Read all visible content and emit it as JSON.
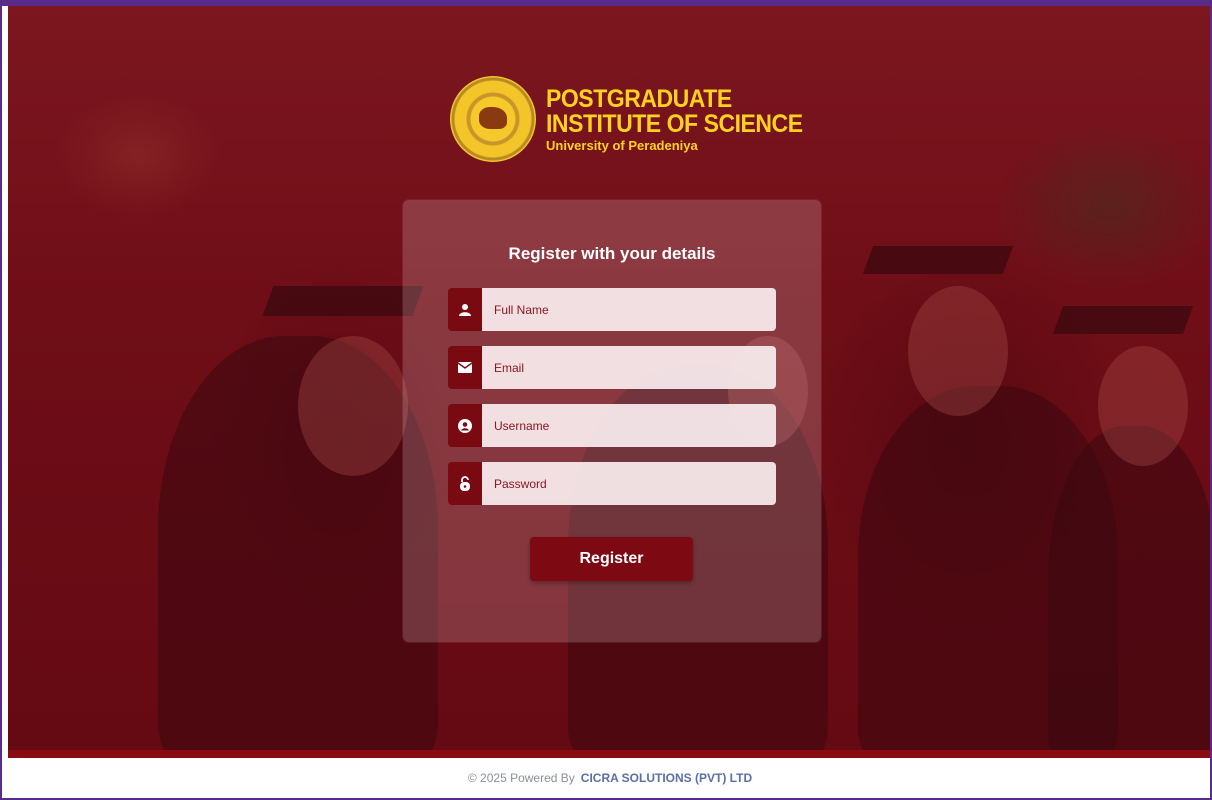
{
  "logo": {
    "line1": "POSTGRADUATE",
    "line2": "INSTITUTE OF SCIENCE",
    "line3": "University of Peradeniya"
  },
  "form": {
    "heading": "Register with your details",
    "fields": [
      {
        "icon": "user-icon",
        "placeholder": "Full Name"
      },
      {
        "icon": "envelope-icon",
        "placeholder": "Email"
      },
      {
        "icon": "user-circle-icon",
        "placeholder": "Username"
      },
      {
        "icon": "lock-icon",
        "placeholder": "Password"
      }
    ],
    "submit_label": "Register"
  },
  "footer": {
    "prefix": "© 2025 Powered By",
    "company": "CICRA SOLUTIONS (PVT) LTD"
  },
  "colors": {
    "accent": "#7d0a12",
    "logo_text": "#ffd21f",
    "footer_link": "#5a6ea8"
  }
}
